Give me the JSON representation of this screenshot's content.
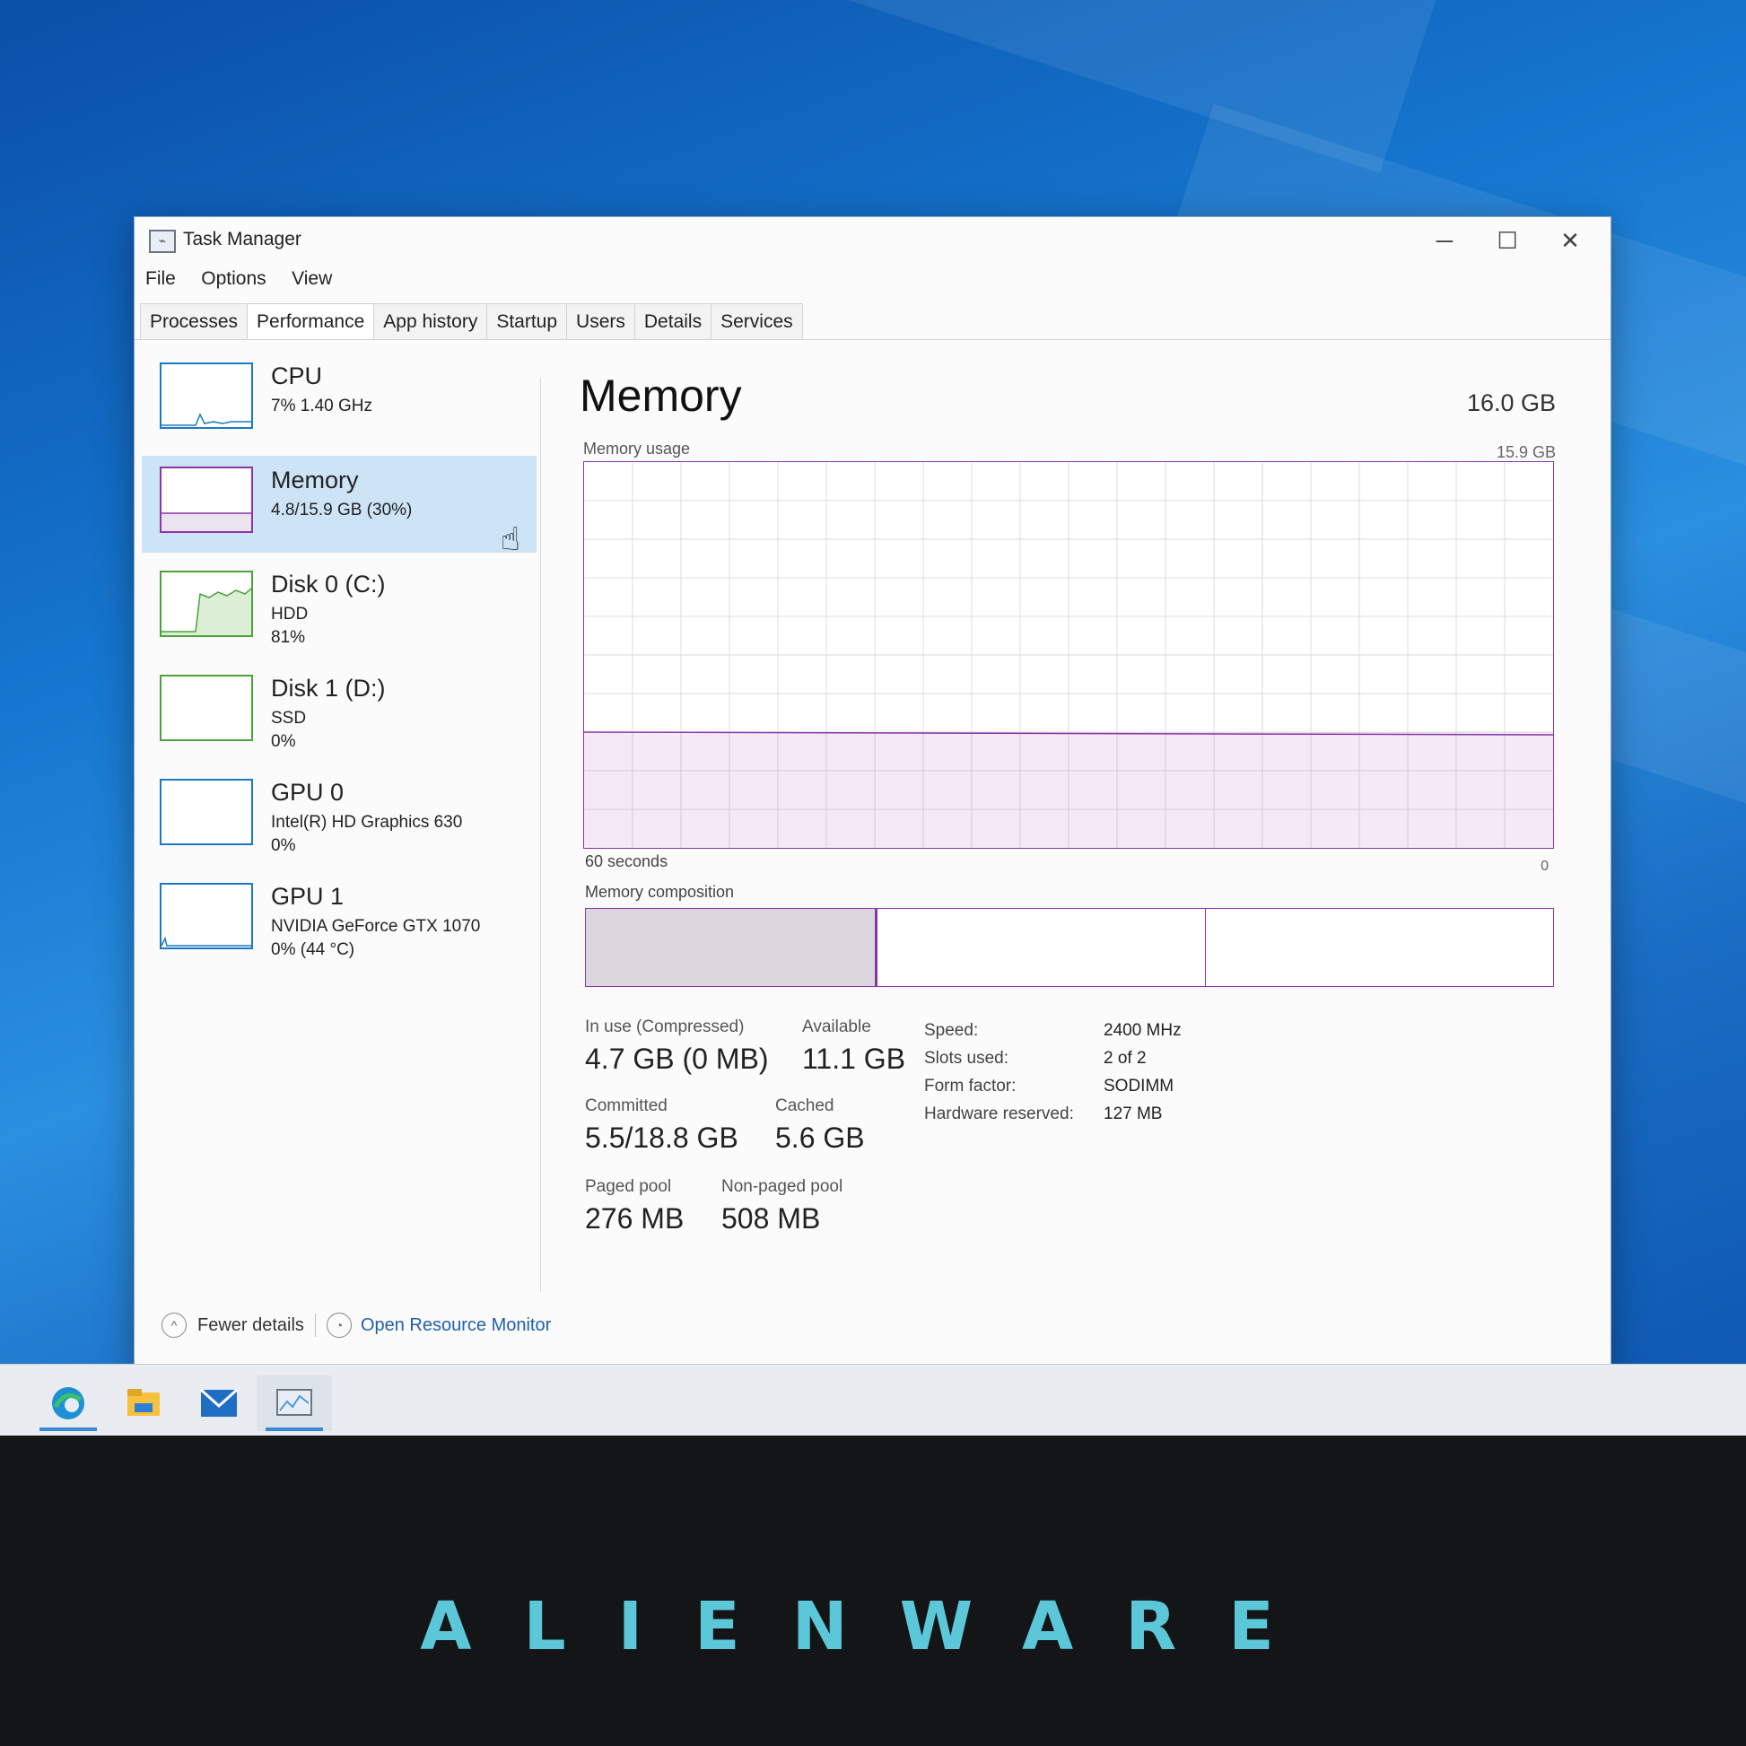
{
  "window": {
    "title": "Task Manager",
    "minimize_glyph": "─",
    "maximize_glyph": "☐",
    "close_glyph": "✕"
  },
  "menu": [
    "File",
    "Options",
    "View"
  ],
  "tabs": [
    {
      "label": "Processes",
      "active": false
    },
    {
      "label": "Performance",
      "active": true
    },
    {
      "label": "App history",
      "active": false
    },
    {
      "label": "Startup",
      "active": false
    },
    {
      "label": "Users",
      "active": false
    },
    {
      "label": "Details",
      "active": false
    },
    {
      "label": "Services",
      "active": false
    }
  ],
  "sidebar": {
    "items": [
      {
        "name": "CPU",
        "line1": "7% 1.40 GHz",
        "line2": "",
        "color": "#1a7ac0",
        "selected": false
      },
      {
        "name": "Memory",
        "line1": "4.8/15.9 GB (30%)",
        "line2": "",
        "color": "#8b35a8",
        "selected": true
      },
      {
        "name": "Disk 0 (C:)",
        "line1": "HDD",
        "line2": "81%",
        "color": "#4aa33a",
        "selected": false
      },
      {
        "name": "Disk 1 (D:)",
        "line1": "SSD",
        "line2": "0%",
        "color": "#4aa33a",
        "selected": false
      },
      {
        "name": "GPU 0",
        "line1": "Intel(R) HD Graphics 630",
        "line2": "0%",
        "color": "#1a7ac0",
        "selected": false
      },
      {
        "name": "GPU 1",
        "line1": "NVIDIA GeForce GTX 1070",
        "line2": "0% (44 °C)",
        "color": "#1a7ac0",
        "selected": false
      }
    ]
  },
  "main": {
    "title": "Memory",
    "total": "16.0 GB",
    "usage_label": "Memory usage",
    "usage_max": "15.9 GB",
    "axis_left": "60 seconds",
    "axis_right": "0",
    "composition_label": "Memory composition",
    "accent": "#8b35a8",
    "usage_level": 0.3,
    "composition": [
      {
        "part": "in use",
        "share": 0.3
      },
      {
        "part": "standby",
        "share": 0.34
      },
      {
        "part": "free",
        "share": 0.36
      }
    ],
    "stats": {
      "in_use_label": "In use (Compressed)",
      "in_use_value": "4.7 GB (0 MB)",
      "available_label": "Available",
      "available_value": "11.1 GB",
      "committed_label": "Committed",
      "committed_value": "5.5/18.8 GB",
      "cached_label": "Cached",
      "cached_value": "5.6 GB",
      "paged_label": "Paged pool",
      "paged_value": "276 MB",
      "nonpaged_label": "Non-paged pool",
      "nonpaged_value": "508 MB"
    },
    "specs": [
      {
        "key": "Speed:",
        "value": "2400 MHz"
      },
      {
        "key": "Slots used:",
        "value": "2 of 2"
      },
      {
        "key": "Form factor:",
        "value": "SODIMM"
      },
      {
        "key": "Hardware reserved:",
        "value": "127 MB"
      }
    ]
  },
  "footer": {
    "fewer_details": "Fewer details",
    "open_resource_monitor": "Open Resource Monitor"
  },
  "taskbar": {
    "icons": [
      "edge-icon",
      "file-explorer-icon",
      "mail-icon",
      "task-manager-icon"
    ]
  },
  "bezel": {
    "brand": "ALIENWARE"
  }
}
